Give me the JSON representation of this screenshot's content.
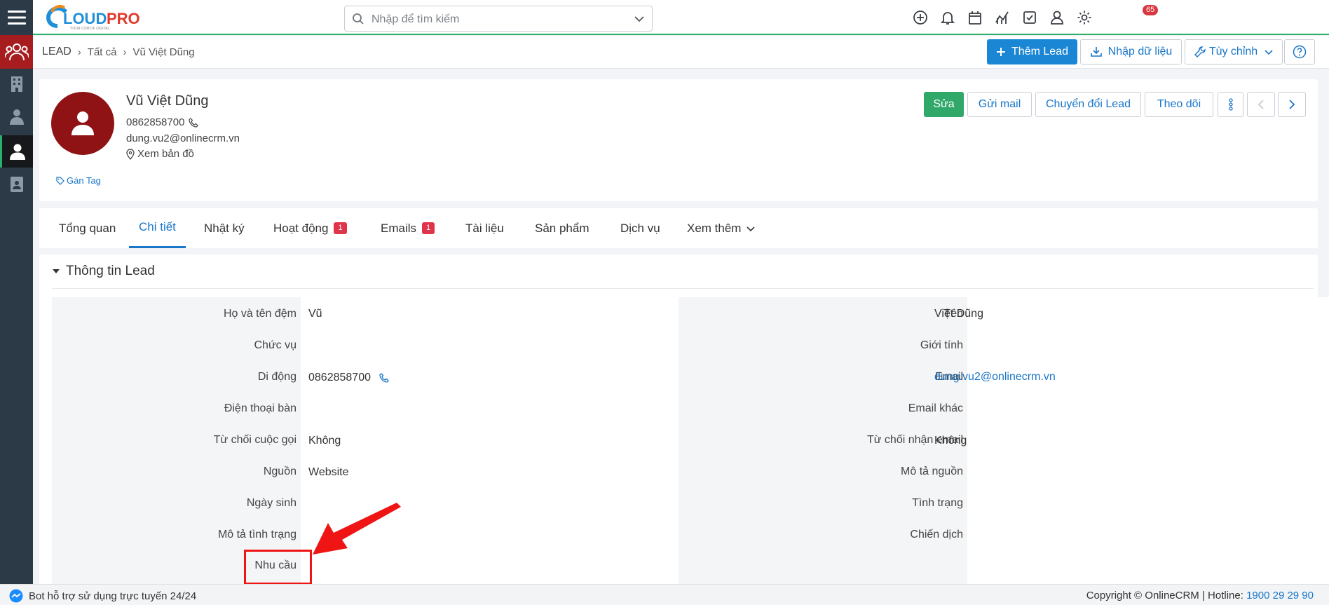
{
  "brand": {
    "name": "CLOUDPRO",
    "tagline": "YOUR COM OF DIGITAL"
  },
  "search": {
    "placeholder": "Nhập để tìm kiếm"
  },
  "notifications": {
    "count": "65"
  },
  "breadcrumb": [
    "LEAD",
    "Tất cả",
    "Vũ Việt Dũng"
  ],
  "header_buttons": {
    "add": "Thêm Lead",
    "import": "Nhập dữ liệu",
    "customize": "Tùy chỉnh"
  },
  "lead": {
    "name": "Vũ Việt Dũng",
    "phone": "0862858700",
    "email": "dung.vu2@onlinecrm.vn",
    "map": "Xem bản đồ",
    "tag": "Gán Tag"
  },
  "actions": {
    "edit": "Sửa",
    "mail": "Gửi mail",
    "convert": "Chuyển đổi Lead",
    "follow": "Theo dõi"
  },
  "tabs": [
    {
      "label": "Tổng quan"
    },
    {
      "label": "Chi tiết",
      "active": true
    },
    {
      "label": "Nhật ký"
    },
    {
      "label": "Hoạt động",
      "badge": "1"
    },
    {
      "label": "Emails",
      "badge": "1"
    },
    {
      "label": "Tài liệu"
    },
    {
      "label": "Sản phẩm"
    },
    {
      "label": "Dịch vụ"
    },
    {
      "label": "Xem thêm"
    }
  ],
  "section": {
    "title": "Thông tin Lead"
  },
  "fields_left": [
    {
      "label": "Họ và tên đệm",
      "value": "Vũ"
    },
    {
      "label": "Chức vụ",
      "value": ""
    },
    {
      "label": "Di động",
      "value": "0862858700"
    },
    {
      "label": "Điện thoại bàn",
      "value": ""
    },
    {
      "label": "Từ chối cuộc gọi",
      "value": "Không"
    },
    {
      "label": "Nguồn",
      "value": "Website"
    },
    {
      "label": "Ngày sinh",
      "value": ""
    },
    {
      "label": "Mô tả tình trạng",
      "value": ""
    },
    {
      "label": "Nhu cầu",
      "value": ""
    }
  ],
  "fields_right": [
    {
      "label": "Tên",
      "value": "Việt Dũng"
    },
    {
      "label": "Giới tính",
      "value": ""
    },
    {
      "label": "Email",
      "value": "dung.vu2@onlinecrm.vn"
    },
    {
      "label": "Email khác",
      "value": ""
    },
    {
      "label": "Từ chối nhận email",
      "value": "Không"
    },
    {
      "label": "Mô tả nguồn",
      "value": ""
    },
    {
      "label": "Tình trạng",
      "value": ""
    },
    {
      "label": "Chiến dịch",
      "value": ""
    }
  ],
  "footer": {
    "bot": "Bot hỗ trợ sử dụng trực tuyến 24/24",
    "copyright": "Copyright © OnlineCRM | Hotline:",
    "hotline": "1900 29 29 90"
  },
  "colors": {
    "rail": "#2c3a47",
    "leads_active": "#a71d1f",
    "primary": "#1b87d4",
    "edit": "#2fa86a",
    "badge": "#e0344a",
    "highlight": "#f01515"
  }
}
